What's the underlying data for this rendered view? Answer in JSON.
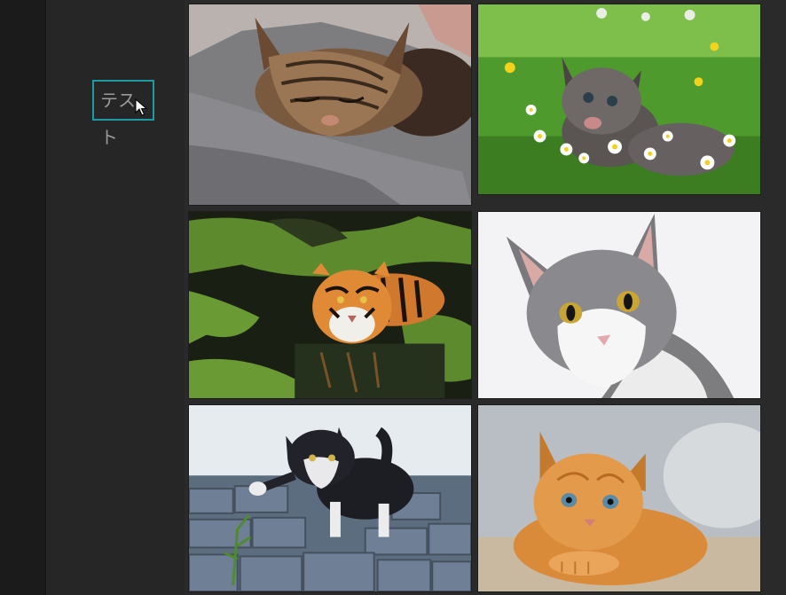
{
  "sidebar": {
    "test_button_label": "テスト"
  },
  "gallery": {
    "images": [
      {
        "subject": "sleeping-tabby-cat"
      },
      {
        "subject": "kitten-in-daisy-field"
      },
      {
        "subject": "tiger-in-water"
      },
      {
        "subject": "gray-white-cat-portrait"
      },
      {
        "subject": "kitten-playing-with-plant"
      },
      {
        "subject": "orange-kitten-lying"
      }
    ]
  },
  "colors": {
    "focus_border": "#1d9aa3",
    "background": "#262626",
    "rail": "#1b1b1b"
  }
}
